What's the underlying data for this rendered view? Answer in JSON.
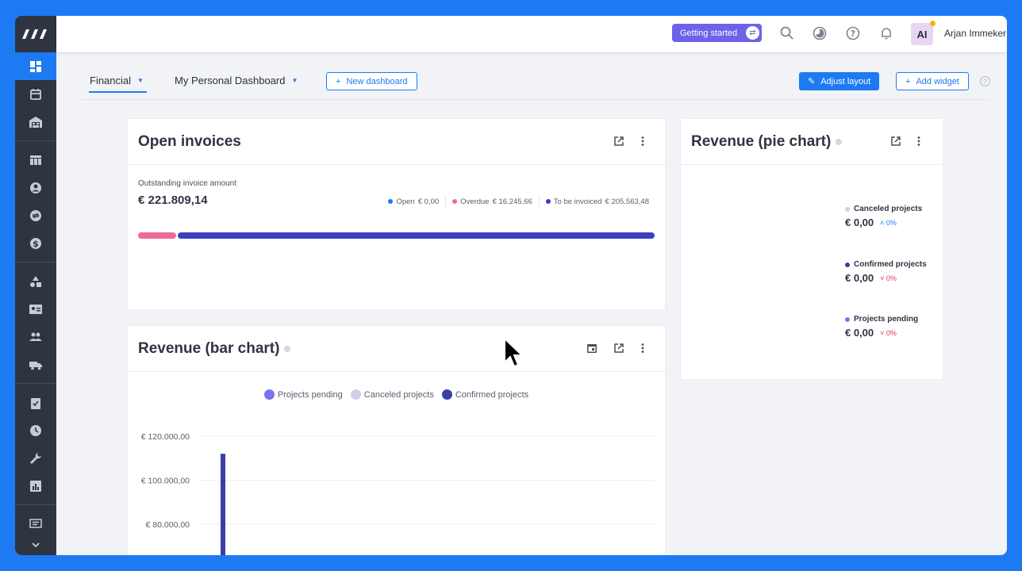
{
  "topbar": {
    "getting_started": "Getting started",
    "user_initials": "AI",
    "user_name": "Arjan Immeker"
  },
  "tabs": {
    "financial": "Financial",
    "personal": "My Personal Dashboard",
    "new_dashboard": "New dashboard",
    "adjust_layout": "Adjust layout",
    "add_widget": "Add widget"
  },
  "open_invoices": {
    "title": "Open invoices",
    "subtitle": "Outstanding invoice amount",
    "amount": "€ 221.809,14",
    "legend": [
      {
        "label": "Open",
        "value": "€ 0,00",
        "color": "#1d7af3"
      },
      {
        "label": "Overdue",
        "value": "€ 16.245,66",
        "color": "#f06b93"
      },
      {
        "label": "To be invoiced",
        "value": "€ 205.563,48",
        "color": "#3a3fc4"
      }
    ],
    "bar_fractions": [
      0.0,
      0.0732,
      0.9268
    ]
  },
  "revenue_pie": {
    "title": "Revenue (pie chart)",
    "items": [
      {
        "label": "Canceled projects",
        "value": "€ 0,00",
        "pct": "0%",
        "dot_color": "#cfd1e8",
        "pct_color": "#1d7af3"
      },
      {
        "label": "Confirmed projects",
        "value": "€ 0,00",
        "pct": "0%",
        "dot_color": "#3a3fa6",
        "pct_color": "#d9365c"
      },
      {
        "label": "Projects pending",
        "value": "€ 0,00",
        "pct": "0%",
        "dot_color": "#7b74ee",
        "pct_color": "#d9365c"
      }
    ]
  },
  "revenue_bar": {
    "title": "Revenue (bar chart)"
  },
  "chart_data": {
    "type": "bar",
    "title": "Revenue (bar chart)",
    "xlabel": "",
    "ylabel": "",
    "ylim": [
      70000,
      120000
    ],
    "y_ticks": [
      "€ 120.000,00",
      "€ 100.000,00",
      "€ 80.000,00"
    ],
    "y_tick_values": [
      120000,
      100000,
      80000
    ],
    "legend_position": "top-center",
    "series": [
      {
        "name": "Projects pending",
        "color": "#7b74ee",
        "values": []
      },
      {
        "name": "Canceled projects",
        "color": "#cfd1e8",
        "values": []
      },
      {
        "name": "Confirmed projects",
        "color": "#3a3fa6",
        "values": [
          112000
        ]
      }
    ]
  }
}
